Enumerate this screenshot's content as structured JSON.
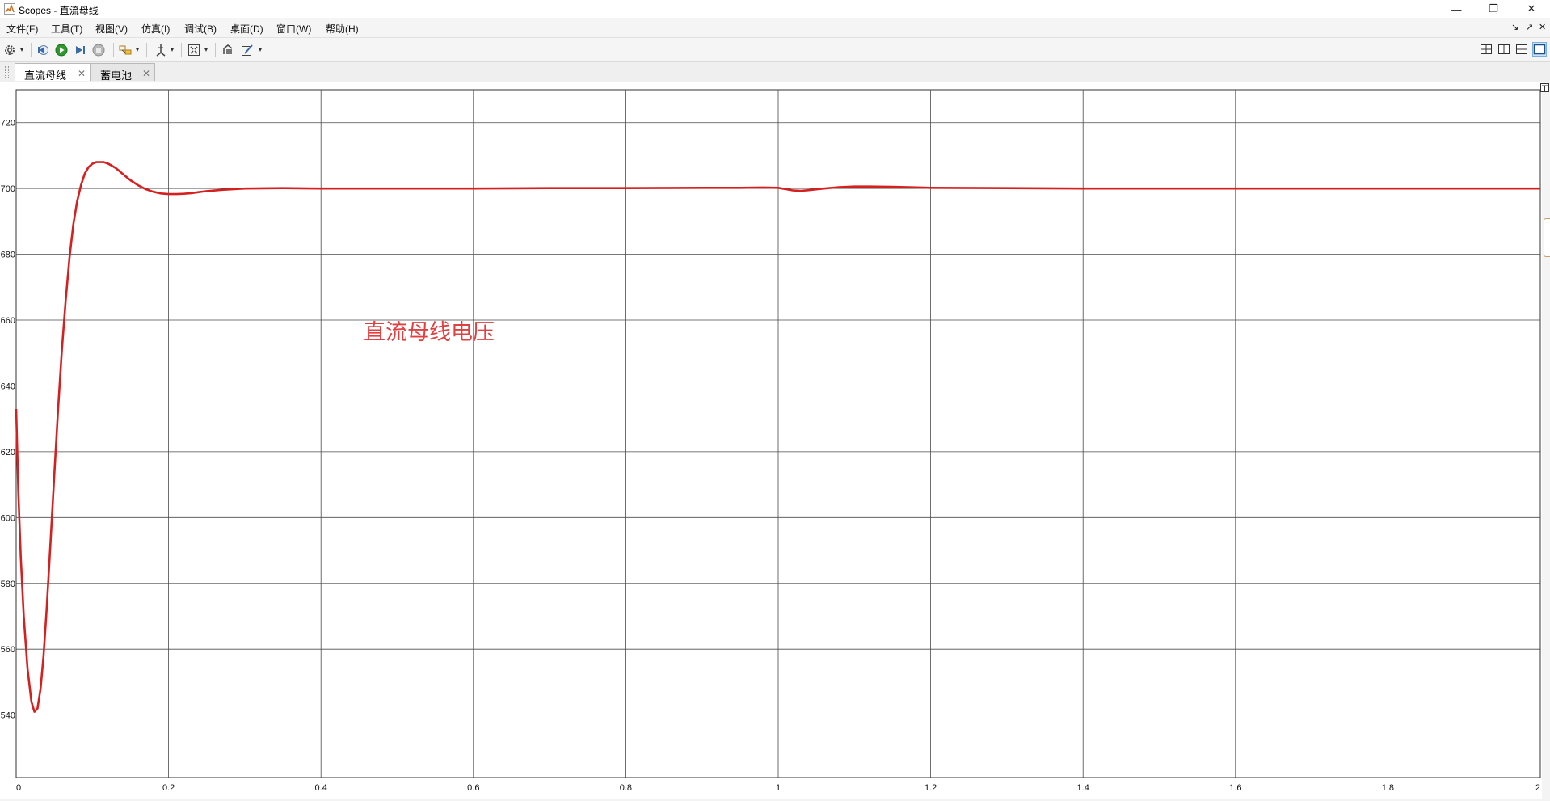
{
  "window": {
    "title": "Scopes - 直流母线",
    "minimize_glyph": "—",
    "maximize_glyph": "❐",
    "close_glyph": "✕"
  },
  "menu": {
    "items": [
      "文件(F)",
      "工具(T)",
      "视图(V)",
      "仿真(I)",
      "调试(B)",
      "桌面(D)",
      "窗口(W)",
      "帮助(H)"
    ],
    "right_glyphs": [
      "↘",
      "↗",
      "✕"
    ]
  },
  "toolbar": {
    "icons": [
      "settings-icon",
      "step-back-icon",
      "run-icon",
      "step-forward-icon",
      "stop-icon",
      "signal-highlight-icon",
      "cursor-measure-icon",
      "zoom-fit-icon",
      "bring-to-front-icon",
      "style-edit-icon"
    ],
    "layout_icons": [
      "layout-2x2-icon",
      "layout-columns-icon",
      "layout-rows-icon",
      "layout-single-icon"
    ]
  },
  "tabs": [
    {
      "label": "直流母线",
      "active": true
    },
    {
      "label": "蓄电池",
      "active": false
    }
  ],
  "colors": {
    "trace": "#d62020",
    "annotation": "#e04040",
    "grid": "#4a4a4a",
    "plot_bg": "#ffffff"
  },
  "chart_data": {
    "type": "line",
    "title": "",
    "xlabel": "",
    "ylabel": "",
    "annotation": "直流母线电压",
    "xlim": [
      0,
      2
    ],
    "ylim": [
      521,
      730
    ],
    "xticks": [
      0,
      0.2,
      0.4,
      0.6,
      0.8,
      1,
      1.2,
      1.4,
      1.6,
      1.8,
      2
    ],
    "xtick_labels": [
      "0",
      "0.2",
      "0.4",
      "0.6",
      "0.8",
      "1",
      "1.2",
      "1.4",
      "1.6",
      "1.8",
      "2"
    ],
    "yticks": [
      540,
      560,
      580,
      600,
      620,
      640,
      660,
      680,
      700,
      720
    ],
    "ytick_labels": [
      "540",
      "560",
      "580",
      "600",
      "620",
      "640",
      "660",
      "680",
      "700",
      "720"
    ],
    "grid": true,
    "series": [
      {
        "x": [
          0,
          0.003,
          0.006,
          0.01,
          0.015,
          0.02,
          0.024,
          0.028,
          0.032,
          0.036,
          0.04,
          0.045,
          0.05,
          0.055,
          0.06,
          0.065,
          0.07,
          0.075,
          0.08,
          0.085,
          0.09,
          0.095,
          0.1,
          0.105,
          0.11,
          0.115,
          0.12,
          0.125,
          0.13,
          0.135,
          0.14,
          0.15,
          0.16,
          0.17,
          0.18,
          0.19,
          0.2,
          0.21,
          0.22,
          0.23,
          0.24,
          0.25,
          0.27,
          0.3,
          0.35,
          0.4,
          0.5,
          0.6,
          0.7,
          0.8,
          0.9,
          0.95,
          0.98,
          1.0,
          1.01,
          1.02,
          1.03,
          1.04,
          1.06,
          1.08,
          1.1,
          1.12,
          1.15,
          1.2,
          1.3,
          1.4,
          1.5,
          1.6,
          1.7,
          1.8,
          1.9,
          2.0
        ],
        "y": [
          633,
          607,
          588,
          570,
          554,
          544,
          541,
          542,
          548,
          558,
          572,
          592,
          613,
          633,
          651,
          666,
          679,
          689,
          696,
          701,
          704.5,
          706.5,
          707.5,
          708,
          708,
          708,
          707.6,
          707,
          706.3,
          705.4,
          704.4,
          702.5,
          701,
          699.8,
          699,
          698.5,
          698.3,
          698.3,
          698.4,
          698.6,
          698.9,
          699.2,
          699.6,
          700,
          700.1,
          700,
          700,
          700,
          700.1,
          700.1,
          700.2,
          700.2,
          700.3,
          700.2,
          699.8,
          699.4,
          699.3,
          699.5,
          700,
          700.4,
          700.6,
          700.6,
          700.5,
          700.2,
          700.1,
          700,
          700,
          700,
          700,
          700,
          700,
          700
        ]
      }
    ]
  }
}
